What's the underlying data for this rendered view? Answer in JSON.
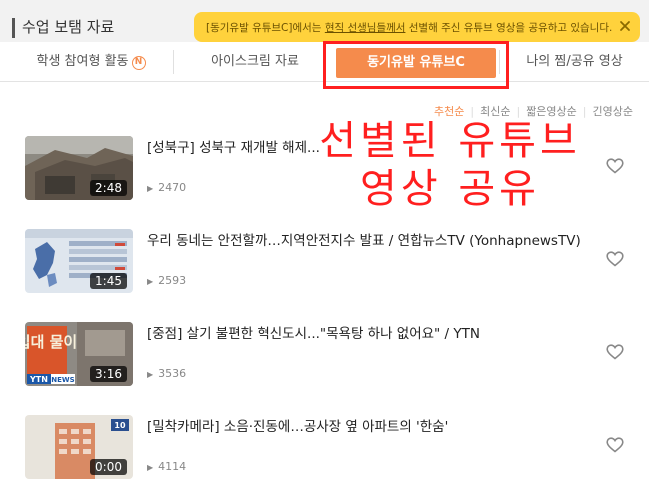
{
  "header": {
    "title": "수업 보탬 자료",
    "notice": {
      "prefix": "[동기유발 유튜브C]에서는 ",
      "underlined": "현직 선생님들께서",
      "suffix": " 선별해 주신 유튜브 영상을 공유하고 있습니다."
    }
  },
  "tabs": [
    {
      "label": "학생 참여형 활동",
      "badge": "N"
    },
    {
      "label": "아이스크림 자료"
    },
    {
      "label": "동기유발 유튜브C",
      "active": true
    },
    {
      "label": "나의 찜/공유 영상"
    }
  ],
  "sort": [
    "추천순",
    "최신순",
    "짧은영상순",
    "긴영상순"
  ],
  "overlay": {
    "line1": "선별된 유튜브",
    "line2": "영상 공유"
  },
  "videos": [
    {
      "title": "[성북구] 성북구 재개발 해제...",
      "views": "2470",
      "duration": "2:48"
    },
    {
      "title": "우리 동네는 안전할까…지역안전지수 발표 / 연합뉴스TV (YonhapnewsTV)",
      "views": "2593",
      "duration": "1:45"
    },
    {
      "title": "[중점] 살기 불편한 혁신도시...\"목욕탕 하나 없어요\" / YTN",
      "views": "3536",
      "duration": "3:16",
      "thumb_text": "입대 물이",
      "channel": "YTN",
      "channel_tag": "NEWS"
    },
    {
      "title": "[밀착카메라] 소음·진동에…공사장 옆 아파트의 '한숨'",
      "views": "4114",
      "duration": "0:00",
      "channel_number": "10"
    }
  ],
  "colors": {
    "accent": "#f58b4c",
    "notice_bg": "#ffd23c",
    "annotation": "#ff1f1f"
  }
}
